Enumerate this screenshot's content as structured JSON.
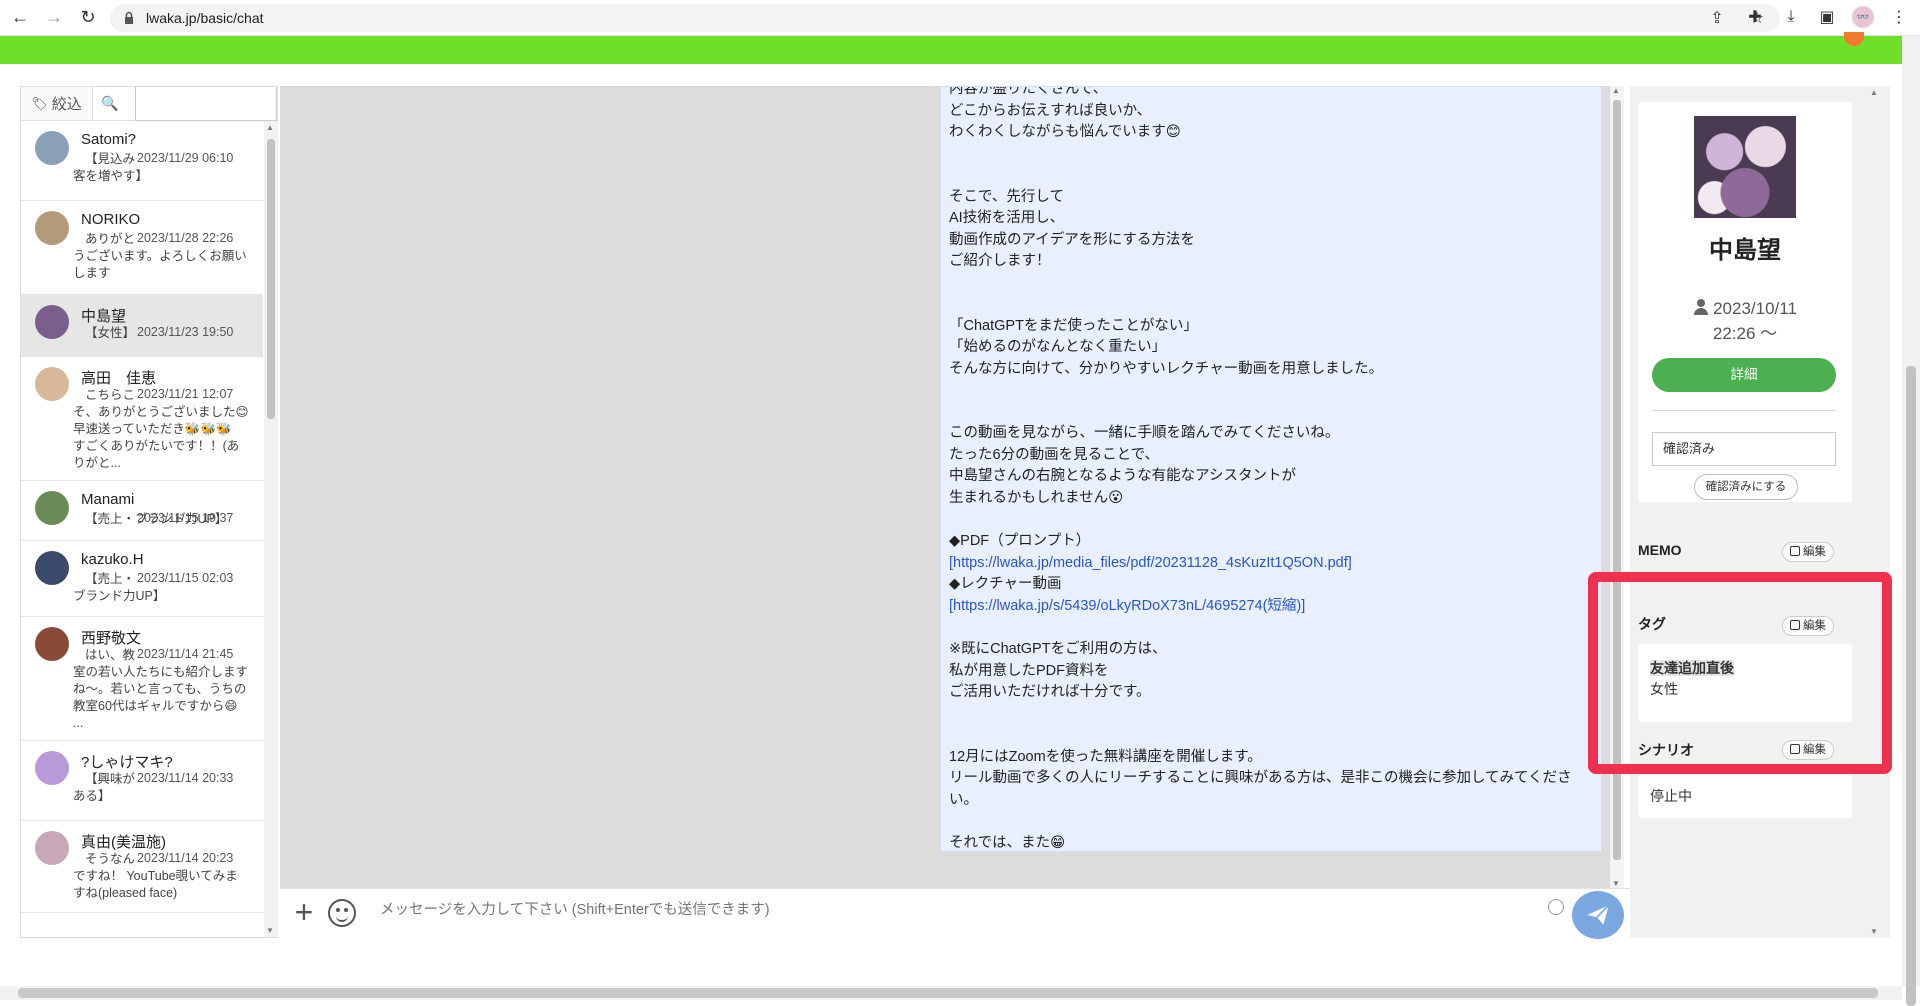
{
  "browser": {
    "url": "lwaka.jp/basic/chat"
  },
  "filter": {
    "label": "絞込",
    "search_placeholder": ""
  },
  "contacts": [
    {
      "name": "Satomi?",
      "date": "2023/11/29 06:10",
      "preview": "【見込み\n客を増やす】",
      "color": "#8aa0b8"
    },
    {
      "name": "NORIKO",
      "date": "2023/11/28 22:26",
      "preview": "ありがと\nうございます。よろしくお願い\nします",
      "color": "#b59a7a"
    },
    {
      "name": "中島望",
      "date": "2023/11/23 19:50",
      "preview": "【女性】",
      "color": "#7a5e8c"
    },
    {
      "name": "高田　佳恵",
      "date": "2023/11/21 12:07",
      "preview": "こちらこ\nそ、ありがとうございました😊\n早速送っていただき🐝🐝🐝\nすごくありがたいです！！(あ\nりがと...",
      "color": "#d8b89a"
    },
    {
      "name": "Manami",
      "date": "2023/11/15 19:37",
      "preview": "【売上・ブランド力UP】",
      "color": "#6a8a5a"
    },
    {
      "name": "kazuko.H",
      "date": "2023/11/15 02:03",
      "preview": "【売上・\nブランド力UP】",
      "color": "#3a4a6a"
    },
    {
      "name": "西野敬文",
      "date": "2023/11/14 21:45",
      "preview": "はい、教\n室の若い人たちにも紹介します\nね〜。若いと言っても、うちの\n教室60代はギャルですから😄\n...",
      "color": "#8a4a3a"
    },
    {
      "name": "?しゃけマキ?",
      "date": "2023/11/14 20:33",
      "preview": "【興味が\nある】",
      "color": "#b89ad8"
    },
    {
      "name": "真由(美温施)",
      "date": "2023/11/14 20:23",
      "preview": "そうなん\nですね！ YouTube覗いてみま\nすね(pleased face)",
      "color": "#c8a8b8"
    }
  ],
  "message": {
    "block1": "内容が盛りたくさんで、\nどこからお伝えすれば良いか、\nわくわくしながらも悩んでいます😊",
    "block2": "そこで、先行して\nAI技術を活用し、\n動画作成のアイデアを形にする方法を\nご紹介します！",
    "block3": "「ChatGPTをまだ使ったことがない」\n「始めるのがなんとなく重たい」\nそんな方に向けて、分かりやすいレクチャー動画を用意しました。",
    "block4": "この動画を見ながら、一緒に手順を踏んでみてくださいね。\nたった6分の動画を見ることで、\n中島望さんの右腕となるような有能なアシスタントが\n生まれるかもしれません😮",
    "pdf_label": "◆PDF（プロンプト）",
    "pdf_link": "[https://lwaka.jp/media_files/pdf/20231128_4sKuzIt1Q5ON.pdf]",
    "video_label": "◆レクチャー動画",
    "video_link": "[https://lwaka.jp/s/5439/oLkyRDoX73nL/4695274(短縮)]",
    "block5": "※既にChatGPTをご利用の方は、\n私が用意したPDF資料を\nご活用いただければ十分です。",
    "block6": "12月にはZoomを使った無料講座を開催します。\nリール動画で多くの人にリーチすることに興味がある方は、是非この機会に参加してみてくださ\nい。",
    "block7": "それでは、また😁"
  },
  "input": {
    "placeholder": "メッセージを入力して下さい (Shift+Enterでも送信できます)"
  },
  "profile": {
    "name": "中島望",
    "date_line1": "2023/10/11",
    "date_line2": "22:26 〜",
    "detail_label": "詳細",
    "status_value": "確認済み",
    "confirm_label": "確認済みにする"
  },
  "memo": {
    "title": "MEMO",
    "edit_label": "編集"
  },
  "tags": {
    "title": "タグ",
    "edit_label": "編集",
    "items": [
      "友達追加直後",
      "女性"
    ]
  },
  "scenario": {
    "title": "シナリオ",
    "edit_label": "編集",
    "value": "停止中"
  },
  "colors": {
    "header_green": "#6fe02a",
    "detail_button": "#4caf50",
    "send_button": "#7aa7e0",
    "highlight_red": "#f0304f",
    "bubble_bg": "#e8efff"
  }
}
